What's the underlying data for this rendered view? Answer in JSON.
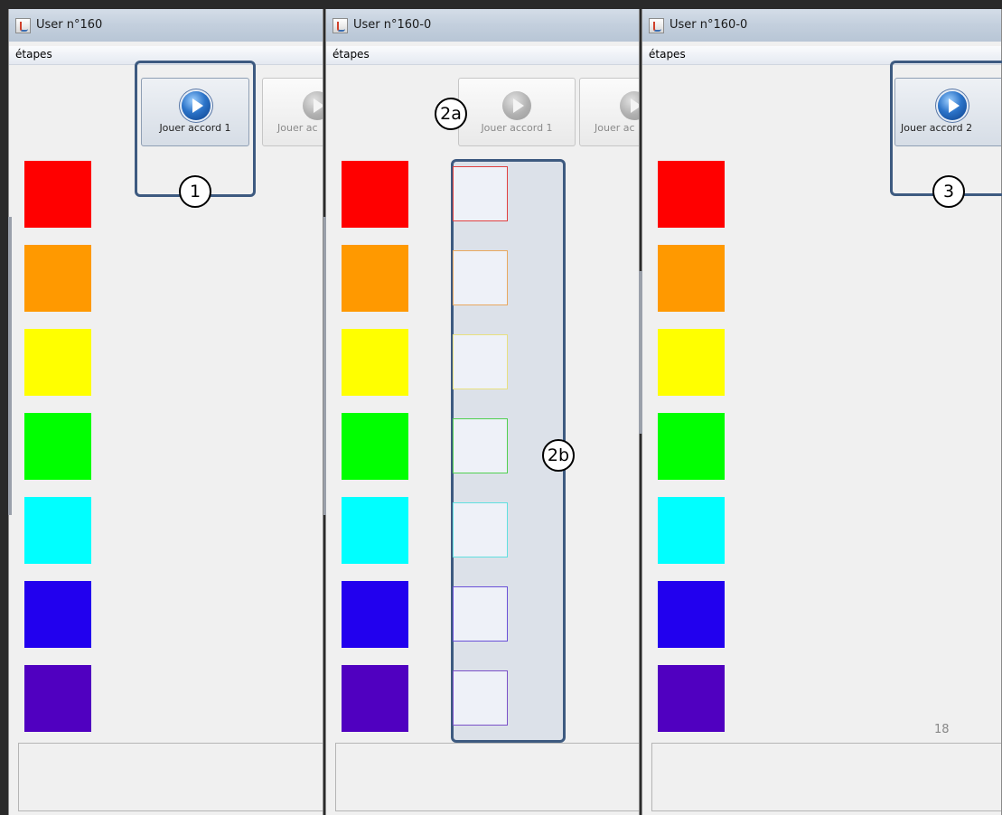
{
  "colors": [
    "#ff0000",
    "#ff9900",
    "#ffff00",
    "#00ff00",
    "#00ffff",
    "#2200ee",
    "#5000c0"
  ],
  "target_borders": [
    "#e04040",
    "#e8a860",
    "#e8e080",
    "#50d050",
    "#60e0e0",
    "#6a50d8",
    "#7a50c8"
  ],
  "windows": [
    {
      "title": "User n°160",
      "menu": "étapes",
      "buttons": [
        "Jouer accord 1",
        "Jouer ac"
      ],
      "callout": "1"
    },
    {
      "title": "User n°160-0",
      "menu": "étapes",
      "buttons": [
        "Jouer accord 1",
        "Jouer ac"
      ],
      "callout_a": "2a",
      "callout_b": "2b"
    },
    {
      "title": "User n°160-0",
      "menu": "étapes",
      "buttons": [
        "Jouer accord 2"
      ],
      "callout": "3",
      "page_number": "18"
    }
  ]
}
